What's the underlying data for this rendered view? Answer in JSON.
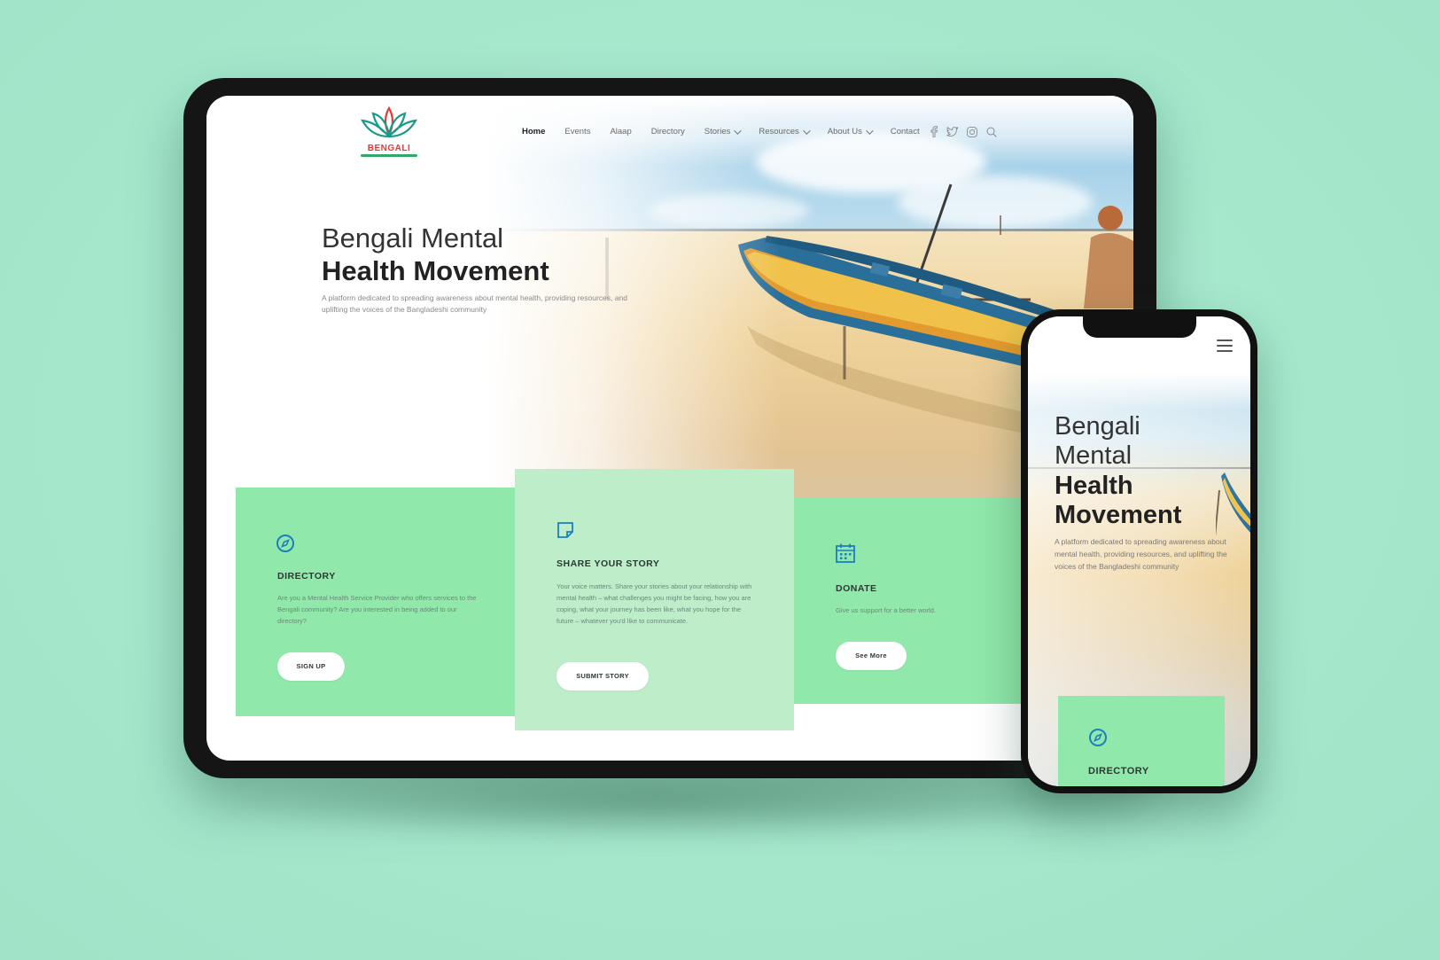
{
  "brand": {
    "name": "BENGALI",
    "colors": {
      "mint_background": "#a8e9cf",
      "card_green": "#90e8aa",
      "card_light_green": "#bdedc9",
      "accent_blue": "#1d7fbf",
      "logo_red": "#e23a3a",
      "logo_teal": "#1a9a8a"
    }
  },
  "nav": {
    "items": [
      {
        "label": "Home",
        "active": true
      },
      {
        "label": "Events"
      },
      {
        "label": "Alaap"
      },
      {
        "label": "Directory"
      },
      {
        "label": "Stories",
        "dropdown": true
      },
      {
        "label": "Resources",
        "dropdown": true
      },
      {
        "label": "About Us",
        "dropdown": true
      },
      {
        "label": "Contact"
      }
    ],
    "social_icons": [
      "facebook-icon",
      "twitter-icon",
      "instagram-icon",
      "search-icon"
    ]
  },
  "hero": {
    "title_line1": "Bengali Mental",
    "title_line2": "Health Movement",
    "description": "A platform dedicated to spreading awareness about mental health, providing resources, and uplifting the voices of the Bangladeshi community"
  },
  "cards": [
    {
      "icon": "compass-icon",
      "title": "DIRECTORY",
      "text": "Are you a Mental Health Service Provider who offers services to the Bengali community? Are you interested in being added to our directory?",
      "button": "SIGN UP"
    },
    {
      "icon": "note-icon",
      "title": "SHARE YOUR STORY",
      "text": "Your voice matters. Share your stories about your relationship with mental health – what challenges you might be facing, how you are coping, what your journey has been like, what you hope for the future – whatever you'd like to communicate.",
      "button": "SUBMIT STORY"
    },
    {
      "icon": "calendar-icon",
      "title": "DONATE",
      "text": "Give us support for a better world.",
      "button": "See More"
    }
  ],
  "phone": {
    "title_line1": "Bengali",
    "title_line2": "Mental",
    "title_line3": "Health",
    "title_line4": "Movement",
    "description": "A platform dedicated to spreading awareness about mental health, providing resources, and uplifting the voices of the Bangladeshi community",
    "card_title": "DIRECTORY",
    "menu_icon": "hamburger-menu-icon"
  }
}
